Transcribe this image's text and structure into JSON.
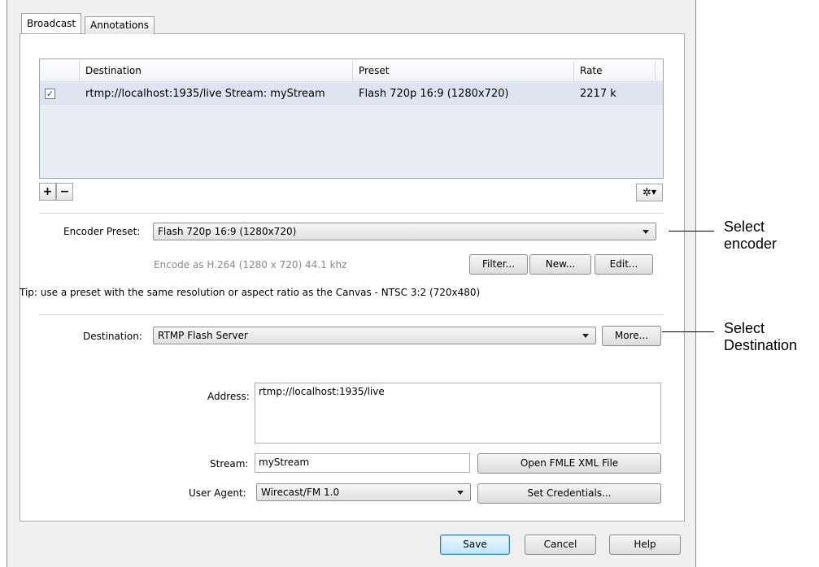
{
  "tabs": [
    {
      "label": "Broadcast"
    },
    {
      "label": "Annotations"
    }
  ],
  "destinations_table": {
    "columns": [
      "Destination",
      "Preset",
      "Rate"
    ],
    "rows": [
      {
        "checked": true,
        "destination": "rtmp://localhost:1935/live Stream: myStream",
        "preset": "Flash 720p 16:9 (1280x720)",
        "rate": "2217 k"
      }
    ]
  },
  "table_controls": {
    "add_label": "+",
    "remove_label": "−",
    "gear_icon": "gear-icon"
  },
  "encoder": {
    "label": "Encoder Preset:",
    "value": "Flash 720p 16:9 (1280x720)",
    "description": "Encode as H.264 (1280 x 720) 44.1 khz",
    "filter_label": "Filter...",
    "new_label": "New...",
    "edit_label": "Edit..."
  },
  "tip": "Tip: use a preset with the same resolution or aspect ratio as the Canvas - NTSC 3:2 (720x480)",
  "destination": {
    "label": "Destination:",
    "value": "RTMP Flash Server",
    "more_label": "More..."
  },
  "address": {
    "label": "Address:",
    "value": "rtmp://localhost:1935/live"
  },
  "stream": {
    "label": "Stream:",
    "value": "myStream",
    "open_fmle_label": "Open FMLE XML File"
  },
  "user_agent": {
    "label": "User Agent:",
    "value": "Wirecast/FM 1.0",
    "set_credentials_label": "Set Credentials..."
  },
  "footer": {
    "save_label": "Save",
    "cancel_label": "Cancel",
    "help_label": "Help"
  },
  "callouts": {
    "encoder_line1": "Select",
    "encoder_line2": "encoder",
    "destination_line1": "Select",
    "destination_line2": "Destination"
  }
}
